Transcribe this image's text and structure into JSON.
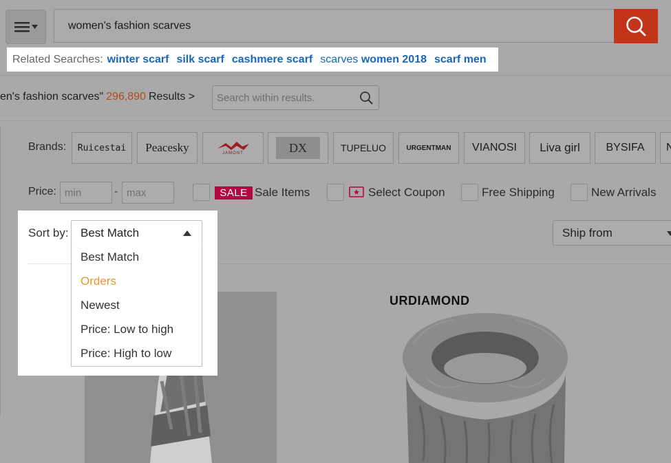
{
  "search": {
    "query": "women's fashion scarves",
    "icons": {
      "menu": "hamburger-icon",
      "dropdown": "caret-down-icon",
      "search": "search-icon"
    }
  },
  "related": {
    "label": "Related Searches:",
    "links": [
      "winter scarf",
      "silk scarf",
      "cashmere scarf"
    ],
    "fourth_prefix": "scarves",
    "fourth_bold": "women 2018",
    "fifth": "scarf men"
  },
  "results": {
    "prefix": "en's fashion scarves\"",
    "count": "296,890",
    "suffix": "Results >",
    "within_placeholder": "Search within results."
  },
  "brands": {
    "label": "Brands:",
    "items": [
      "Ruicestai",
      "Peacesky",
      "JAMONT",
      "DX",
      "TUPELUO",
      "URGENTMAN",
      "VIANOSI",
      "Liva girl",
      "BYSIFA",
      "N"
    ]
  },
  "filters": {
    "price_label": "Price:",
    "min_placeholder": "min",
    "max_placeholder": "max",
    "dash": "-",
    "sale_badge": "SALE",
    "sale_items": "Sale Items",
    "select_coupon": "Select Coupon",
    "free_shipping": "Free Shipping",
    "new_arrivals": "New Arrivals"
  },
  "sort": {
    "label": "Sort by:",
    "selected": "Best Match",
    "options": [
      "Best Match",
      "Orders",
      "Newest",
      "Price: Low to high",
      "Price: High to low"
    ],
    "hover_index": 1
  },
  "ship_from": "Ship from",
  "products": {
    "second_brand": "URDIAMOND"
  },
  "colors": {
    "accent": "#c2351a",
    "link": "#1a66b8",
    "sale": "#b3073f",
    "hover": "#e8962b"
  }
}
